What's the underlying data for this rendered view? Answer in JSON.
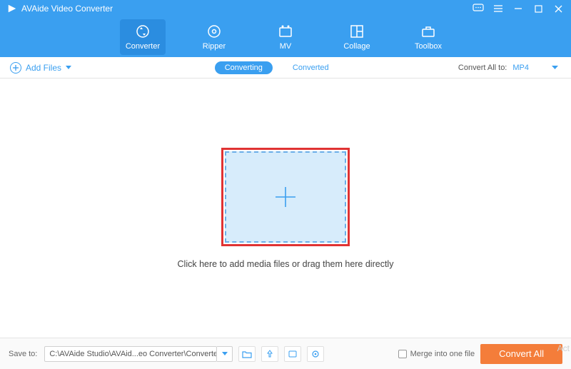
{
  "titlebar": {
    "app_name": "AVAide Video Converter"
  },
  "nav": {
    "converter": "Converter",
    "ripper": "Ripper",
    "mv": "MV",
    "collage": "Collage",
    "toolbox": "Toolbox"
  },
  "secbar": {
    "add_files": "Add Files",
    "converting": "Converting",
    "converted": "Converted",
    "convert_all_to_label": "Convert All to:",
    "format": "MP4"
  },
  "main": {
    "drop_hint": "Click here to add media files or drag them here directly"
  },
  "bottom": {
    "save_to_label": "Save to:",
    "path": "C:\\AVAide Studio\\AVAid...eo Converter\\Converted",
    "merge_label": "Merge into one file",
    "convert_all": "Convert All"
  },
  "watermark": "Act"
}
